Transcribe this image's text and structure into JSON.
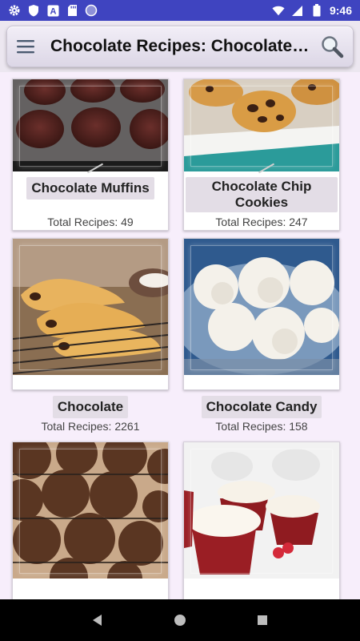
{
  "status_bar": {
    "time": "9:46",
    "left_icons": [
      "gear-icon",
      "shield-icon",
      "a-letter-icon",
      "sd-card-icon",
      "circle-icon"
    ],
    "right_icons": [
      "wifi-icon",
      "signal-icon",
      "battery-icon"
    ]
  },
  "toolbar": {
    "title": "Chocolate Recipes: Chocolate Recipes",
    "menu_icon": "hamburger-menu-icon",
    "search_icon": "search-icon"
  },
  "categories": [
    {
      "title": "Chocolate Muffins",
      "count": "Total Recipes: 49"
    },
    {
      "title": "Chocolate Chip Cookies",
      "count": "Total Recipes: 247"
    },
    {
      "title": "Chocolate",
      "count": "Total Recipes: 2261"
    },
    {
      "title": "Chocolate Candy",
      "count": "Total Recipes: 158"
    },
    {
      "title": "",
      "count": ""
    },
    {
      "title": "",
      "count": ""
    }
  ],
  "nav_bar": {
    "back_icon": "back-triangle-icon",
    "home_icon": "home-circle-icon",
    "recents_icon": "recents-square-icon"
  },
  "colors": {
    "status_bar": "#3f44c0",
    "background": "#f7eefb",
    "title_pill": "#e3dde6"
  }
}
